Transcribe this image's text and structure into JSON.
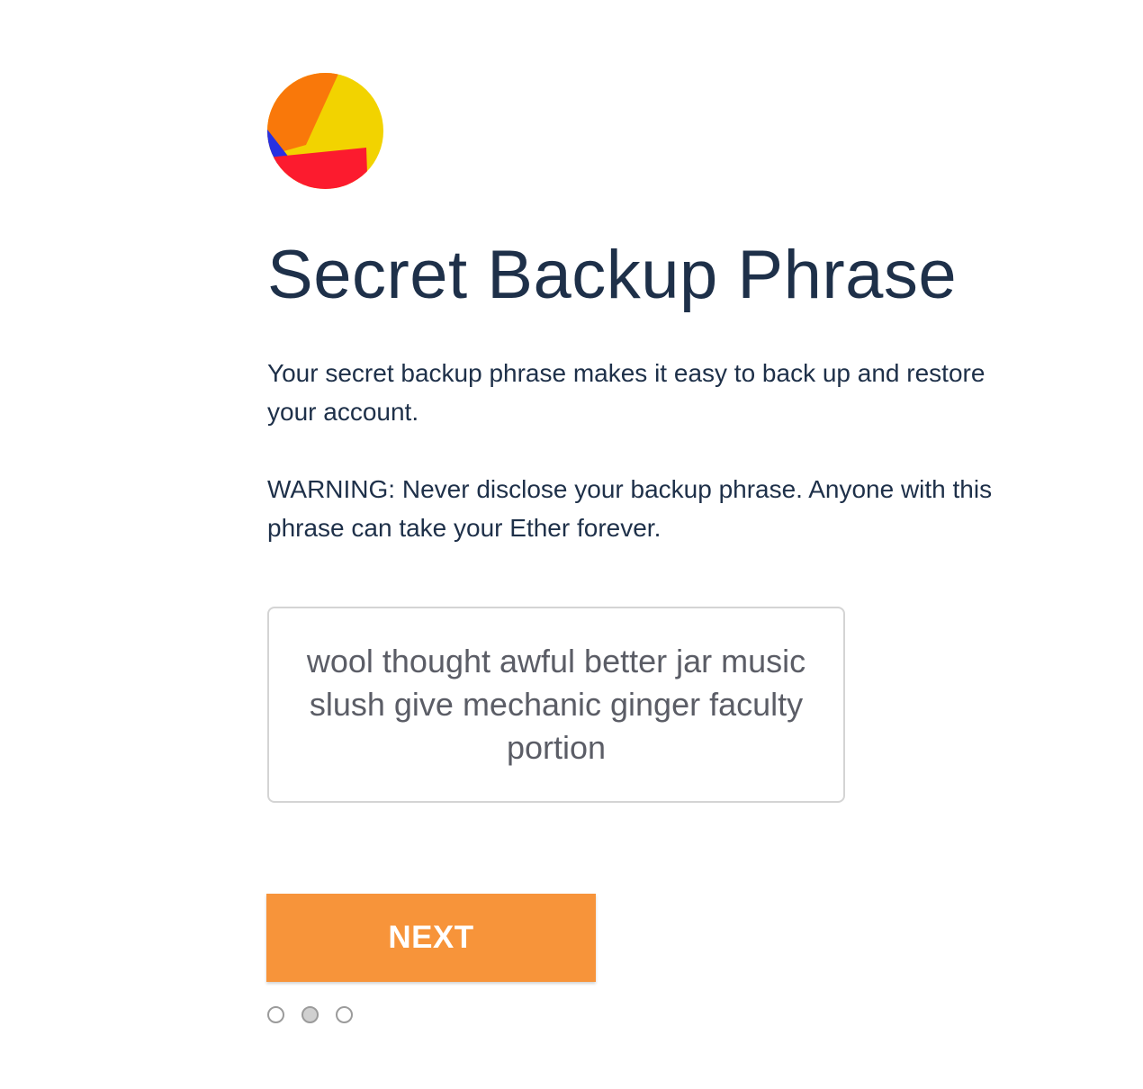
{
  "identicon": {
    "icon": "account-identicon",
    "colors": [
      "#f9780a",
      "#f2d300",
      "#fc1b2e",
      "#2731e2"
    ]
  },
  "title": "Secret Backup Phrase",
  "description": "Your secret backup phrase makes it easy to back up and restore your account.",
  "warning": "WARNING: Never disclose your backup phrase. Anyone with this phrase can take your Ether forever.",
  "seed_phrase": "wool thought awful better jar music slush give mechanic ginger faculty portion",
  "next_button": {
    "label": "NEXT",
    "color": "#f7943a"
  },
  "step_indicator": {
    "total_steps": 3,
    "current_step": 2
  }
}
